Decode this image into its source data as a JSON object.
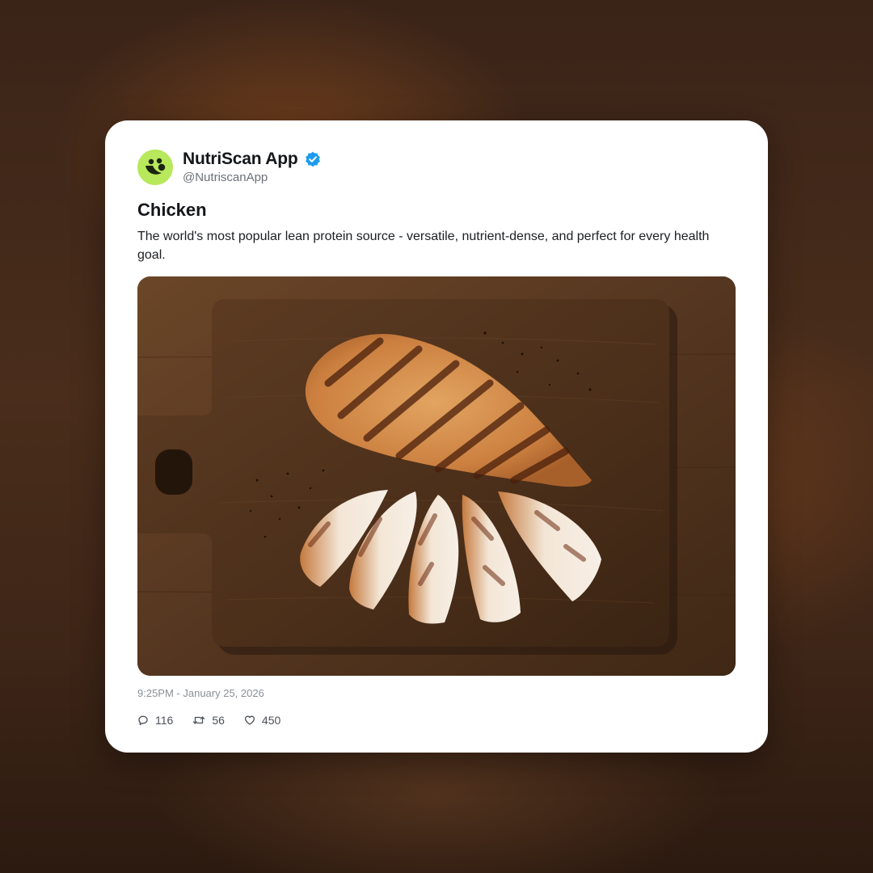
{
  "post": {
    "author": {
      "display_name": "NutriScan App",
      "handle": "@NutriscanApp",
      "verified": true,
      "avatar_icon": "nutriscan-logo-icon",
      "avatar_color": "#b8e85c",
      "verified_color": "#1d9bf0"
    },
    "title": "Chicken",
    "body": "The world's most popular lean protein source - versatile, nutrient-dense, and perfect for every health goal.",
    "image": {
      "subject": "grilled chicken breast on a wooden cutting board"
    },
    "timestamp": "9:25PM - January 25, 2026",
    "stats": {
      "replies": "116",
      "retweets": "56",
      "likes": "450"
    }
  }
}
